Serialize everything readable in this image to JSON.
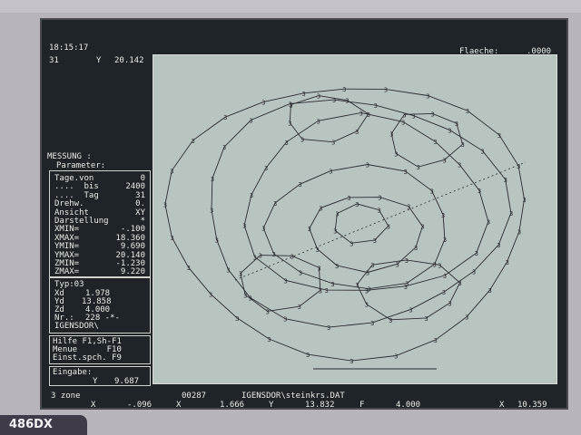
{
  "header": {
    "time": "18:15:17",
    "row2_left": "31",
    "row2_y_label": "Y",
    "row2_y_value": "20.142",
    "area_label": "Flaeche:",
    "area_value": ".0000"
  },
  "left_panel": {
    "messung_title": "MESSUNG :",
    "parameter_label": "Parameter:",
    "params": [
      {
        "label": "Tage.von",
        "value": "0"
      },
      {
        "label": "....  bis",
        "value": "2400"
      },
      {
        "label": "....  Tag",
        "value": "31"
      },
      {
        "label": "Drehw.",
        "value": "0."
      },
      {
        "label": "Ansicht",
        "value": "XY"
      },
      {
        "label": "Darstellung",
        "value": "*"
      },
      {
        "label": "XMIN=",
        "value": "-.100"
      },
      {
        "label": "XMAX=",
        "value": "18.360"
      },
      {
        "label": "YMIN=",
        "value": "9.690"
      },
      {
        "label": "YMAX=",
        "value": "20.140"
      },
      {
        "label": "ZMIN=",
        "value": "-1.230"
      },
      {
        "label": "ZMAX=",
        "value": "9.220"
      }
    ],
    "typ": "Typ:03",
    "xd_label": "Xd",
    "xd_value": "1.978",
    "yd_label": "Yd",
    "yd_value": "13.858",
    "zd_label": "Zd",
    "zd_value": "4.000",
    "nr_label": "Nr.:",
    "nr_value": "228 -*-",
    "place": "IGENSDOR\\",
    "help_line": "Hilfe F1,Sh-F1",
    "menu_line": "Menue      F10",
    "einst_line": "Einst.spch. F9",
    "eingabe_label": "Eingabe:",
    "eingabe_y_label": "Y",
    "eingabe_value": "9.687"
  },
  "status_bar": {
    "zone": "3 zone",
    "code": "00287",
    "file": "IGENSDOR\\steinkrs.DAT",
    "x1_label": "X",
    "x1_value": "-.096",
    "x2_label": "X",
    "x2_value": "1.666",
    "y_label": "Y",
    "y_value": "13.832",
    "f_label": "F",
    "f_value": "4.000",
    "x3_label": "X",
    "x3_value": "10.359"
  },
  "badge": "486DX",
  "colors": {
    "screen_bg": "#1f2428",
    "plot_bg": "#b8c4c0",
    "text": "#e8ece8",
    "line": "#2a2a30"
  }
}
